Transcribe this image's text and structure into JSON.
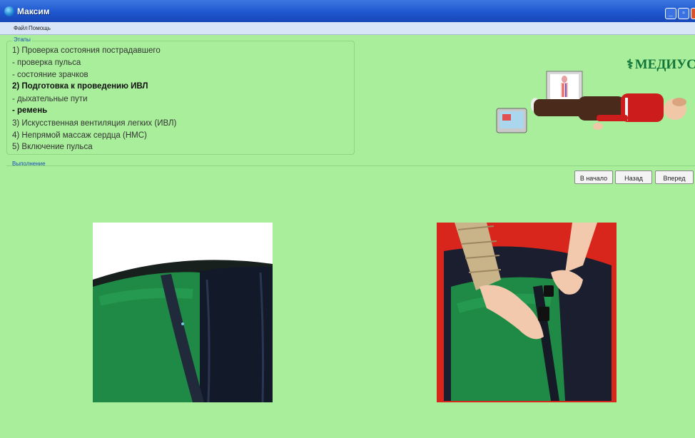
{
  "window": {
    "title": "Максим"
  },
  "menu": {
    "file": "Файл",
    "help": "Помощь"
  },
  "stages": {
    "caption": "Этапы",
    "items": [
      {
        "text": "1) Проверка состояния пострадавшего",
        "bold": false
      },
      {
        "text": "- проверка пульса",
        "bold": false
      },
      {
        "text": "- состояние зрачков",
        "bold": false
      },
      {
        "text": "2) Подготовка к проведению ИВЛ",
        "bold": true
      },
      {
        "text": "- дыхательные пути",
        "bold": false
      },
      {
        "text": "- ремень",
        "bold": true
      },
      {
        "text": "3) Искусственная вентиляция легких (ИВЛ)",
        "bold": false
      },
      {
        "text": "4) Непрямой массаж сердца (НМС)",
        "bold": false
      },
      {
        "text": "5) Включение пульса",
        "bold": false
      }
    ]
  },
  "execution": {
    "caption": "Выполнение"
  },
  "logo": {
    "text": "МЕДИУС"
  },
  "navigation": {
    "start": "В начало",
    "back": "Назад",
    "forward": "Вперед"
  },
  "colors": {
    "background": "#a9ef9b",
    "titlebar": "#2158d2",
    "menubar": "#d8e4f8",
    "accent_text": "#1a4fb5",
    "logo": "#12763a"
  },
  "icons": {
    "app": "globe-icon",
    "minimize": "minimize-icon",
    "maximize": "maximize-icon",
    "close": "close-icon",
    "logo_mark": "caduceus-icon"
  }
}
